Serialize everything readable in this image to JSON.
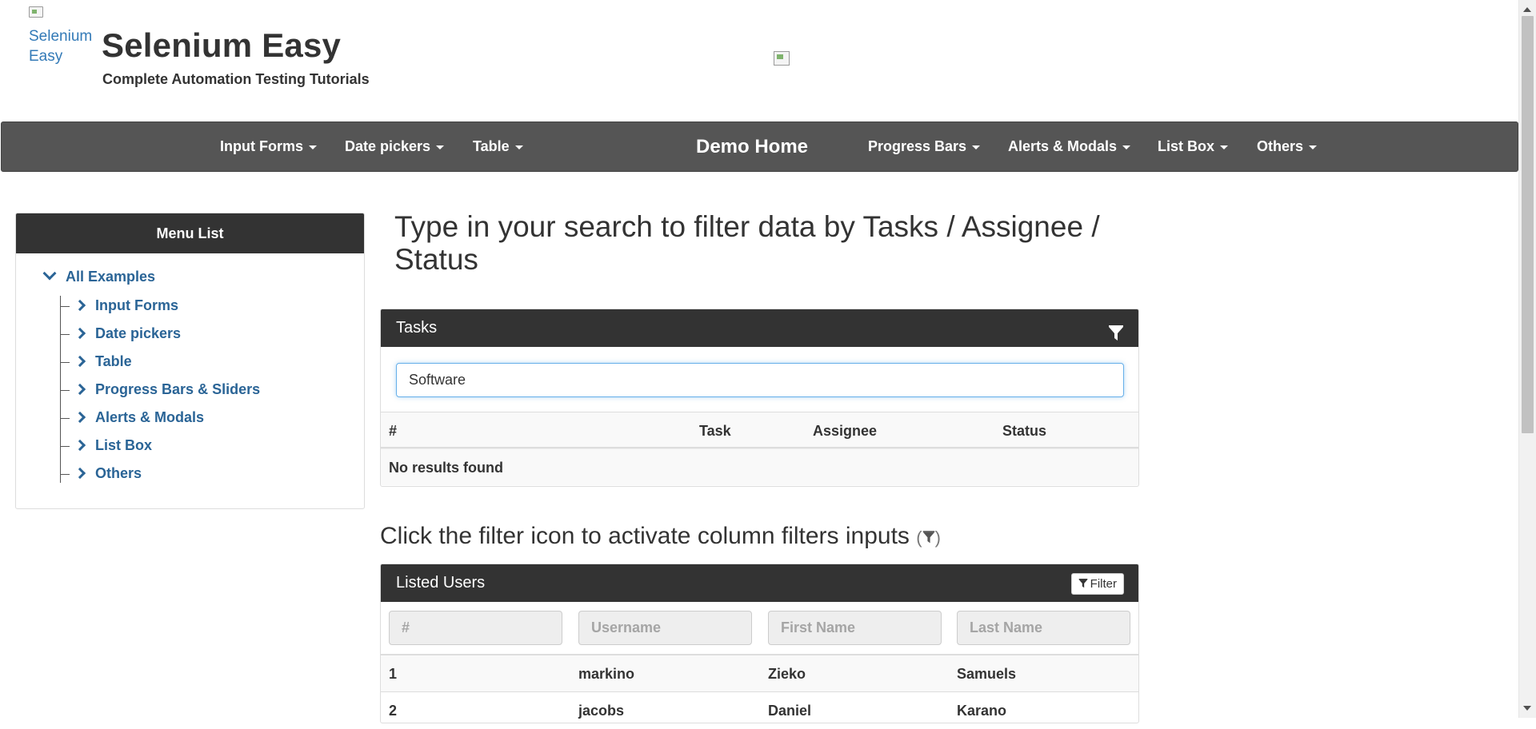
{
  "header": {
    "logo_alt": "Selenium Easy",
    "title": "Selenium Easy",
    "tagline": "Complete Automation Testing Tutorials"
  },
  "nav": {
    "items": [
      {
        "label": "Input Forms",
        "dropdown": true
      },
      {
        "label": "Date pickers",
        "dropdown": true
      },
      {
        "label": "Table",
        "dropdown": true
      },
      {
        "label": "Demo Home",
        "dropdown": false
      },
      {
        "label": "Progress Bars",
        "dropdown": true
      },
      {
        "label": "Alerts & Modals",
        "dropdown": true
      },
      {
        "label": "List Box",
        "dropdown": true
      },
      {
        "label": "Others",
        "dropdown": true
      }
    ]
  },
  "sidebar": {
    "title": "Menu List",
    "root": "All Examples",
    "items": [
      "Input Forms",
      "Date pickers",
      "Table",
      "Progress Bars & Sliders",
      "Alerts & Modals",
      "List Box",
      "Others"
    ]
  },
  "main": {
    "heading": "Type in your search to filter data by Tasks / Assignee / Status",
    "tasks_panel": {
      "title": "Tasks",
      "search_value": "Software",
      "columns": [
        "#",
        "Task",
        "Assignee",
        "Status"
      ],
      "empty_message": "No results found"
    },
    "subheading": "Click the filter icon to activate column filters inputs",
    "users_panel": {
      "title": "Listed Users",
      "filter_button": "Filter",
      "filter_placeholders": [
        "#",
        "Username",
        "First Name",
        "Last Name"
      ],
      "rows": [
        [
          "1",
          "markino",
          "Zieko",
          "Samuels"
        ],
        [
          "2",
          "jacobs",
          "Daniel",
          "Karano"
        ]
      ]
    }
  },
  "colors": {
    "navbar_bg": "#555555",
    "panel_header_bg": "#333333",
    "link": "#2a6496",
    "focus_border": "#66afe9"
  },
  "icons": {
    "panel_filter": "funnel-icon",
    "tree_expand": "chevron-right-icon",
    "tree_collapse": "chevron-down-icon"
  }
}
